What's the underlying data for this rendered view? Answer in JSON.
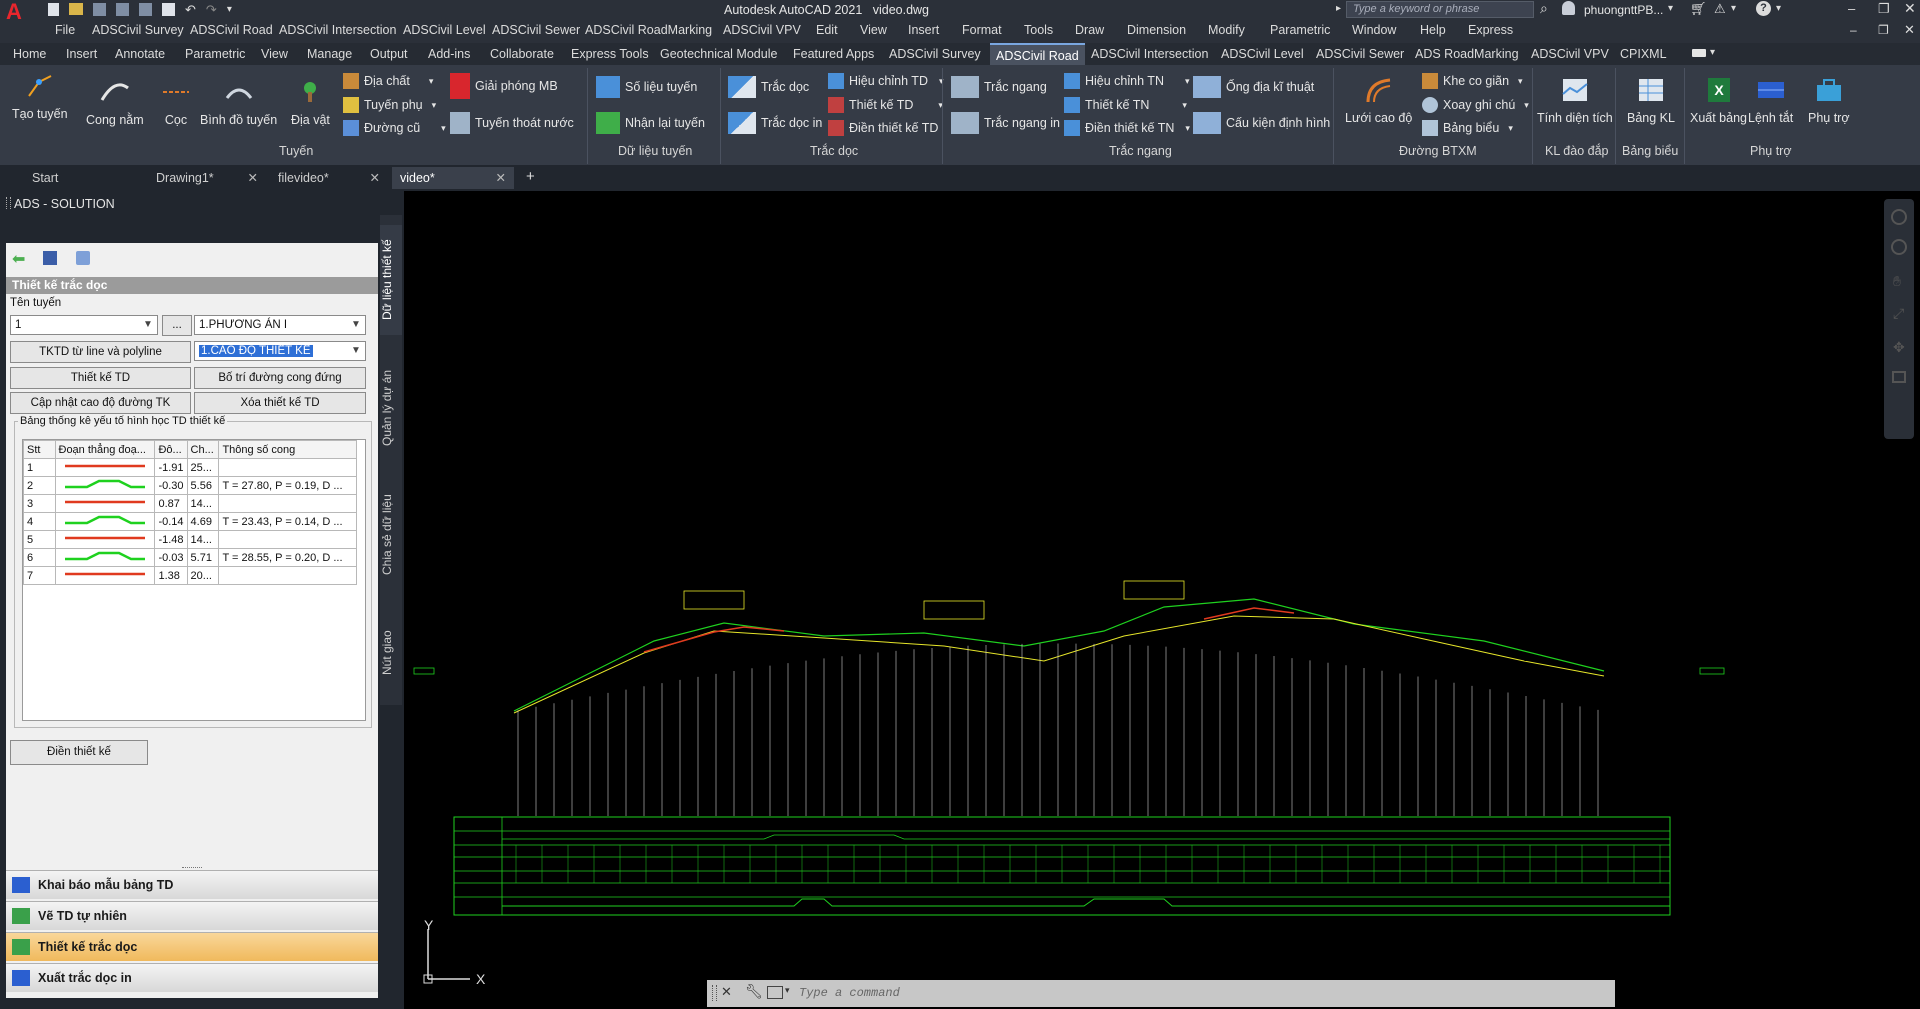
{
  "titlebar": {
    "app_title": "Autodesk AutoCAD 2021",
    "file_name": "video.dwg",
    "search_placeholder": "Type a keyword or phrase",
    "user_name": "phuongnttPB..."
  },
  "menubar": {
    "items": [
      "File",
      "ADSCivil Survey",
      "ADSCivil Road",
      "ADSCivil Intersection",
      "ADSCivil Level",
      "ADSCivil Sewer",
      "ADSCivil RoadMarking",
      "ADSCivil VPV",
      "Edit",
      "View",
      "Insert",
      "Format",
      "Tools",
      "Draw",
      "Dimension",
      "Modify",
      "Parametric",
      "Window",
      "Help",
      "Express"
    ]
  },
  "ribbon_tabs": {
    "items": [
      "Home",
      "Insert",
      "Annotate",
      "Parametric",
      "View",
      "Manage",
      "Output",
      "Add-ins",
      "Collaborate",
      "Express Tools",
      "Geotechnical Module",
      "Featured Apps",
      "ADSCivil Survey",
      "ADSCivil Road",
      "ADSCivil Intersection",
      "ADSCivil Level",
      "ADSCivil Sewer",
      "ADS RoadMarking",
      "ADSCivil VPV",
      "CPIXML"
    ],
    "active": "ADSCivil Road"
  },
  "ribbon": {
    "tuyen": {
      "title": "Tuyến",
      "tao_tuyen": "Tạo tuyến",
      "cong_nam": "Cong nằm",
      "coc": "Cọc",
      "binh_do_tuyen": "Bình đồ tuyến",
      "dia_vat": "Địa vật",
      "dia_chat": "Địa chất",
      "tuyen_phu": "Tuyến phụ",
      "duong_cu": "Đường cũ",
      "giai_phong_mb": "Giải phóng MB",
      "tuyen_thoat_nuoc": "Tuyến thoát nước"
    },
    "du_lieu_tuyen": {
      "title": "Dữ liệu tuyến",
      "so_lieu_tuyen": "Số liệu tuyến",
      "nhan_lai_tuyen": "Nhận lại tuyến"
    },
    "trac_doc": {
      "title": "Trắc dọc",
      "trac_doc": "Trắc dọc",
      "trac_doc_in": "Trắc dọc in",
      "hieu_chinh_td": "Hiệu chỉnh TD",
      "thiet_ke_td": "Thiết kế TD",
      "dien_thiet_ke_td": "Điền thiết kế TD"
    },
    "trac_ngang": {
      "title": "Trắc ngang",
      "trac_ngang": "Trắc ngang",
      "trac_ngang_in": "Trắc ngang in",
      "hieu_chinh_tn": "Hiệu chỉnh TN",
      "thiet_ke_tn": "Thiết kế TN",
      "dien_thiet_ke_tn": "Điền thiết kế TN",
      "ong_dia_ki_thuat": "Ống địa kĩ thuật",
      "cau_kien_dinh_hinh": "Cấu kiện định hình"
    },
    "duong_btxm": {
      "title": "Đường BTXM",
      "luoi_cao_do": "Lưới cao độ",
      "khe_co_gian": "Khe co giãn",
      "xoay_ghi_chu": "Xoay ghi chú",
      "bang_bieu": "Bảng biểu"
    },
    "kl_dao_dap": {
      "title": "KL đào đắp",
      "tinh_dien_tich": "Tính diện tích"
    },
    "bang_bieu_panel": {
      "title": "Bảng biểu",
      "bang_kl": "Bảng KL"
    },
    "phu_tro": {
      "title": "Phụ trợ",
      "xuat_bang": "Xuất bảng",
      "lenh_tat": "Lệnh tắt",
      "phu_tro": "Phụ trợ"
    }
  },
  "doc_tabs": {
    "items": [
      "Start",
      "Drawing1*",
      "filevideo*",
      "video*"
    ],
    "active": "video*"
  },
  "palette": {
    "header": "ADS - SOLUTION",
    "section_title": "Thiết kế trắc dọc",
    "ten_tuyen_label": "Tên tuyến",
    "ten_tuyen_value": "1",
    "browse_button": "...",
    "phuong_an_value": "1.PHƯƠNG ÁN I",
    "cao_do_value": "1.CAO ĐỘ THIẾT KẾ",
    "btn_tktd_line": "TKTD từ line và polyline",
    "btn_thiet_ke_td": "Thiết kế TD",
    "btn_bo_tri": "Bố trí đường cong đứng",
    "btn_cap_nhat": "Cập nhật cao độ đường TK",
    "btn_xoa": "Xóa thiết kế TD",
    "table_label": "Bảng thống kê yếu tố hình học TD thiết kế",
    "columns": [
      "Stt",
      "Đoạn thẳng đoạ...",
      "Đô...",
      "Ch...",
      "Thông số cong"
    ],
    "rows": [
      {
        "stt": "1",
        "type": "line",
        "do": "-1.91",
        "ch": "25...",
        "ts": ""
      },
      {
        "stt": "2",
        "type": "curve",
        "do": "-0.30",
        "ch": "5.56",
        "ts": "T = 27.80, P = 0.19, D ..."
      },
      {
        "stt": "3",
        "type": "line",
        "do": "0.87",
        "ch": "14...",
        "ts": ""
      },
      {
        "stt": "4",
        "type": "curve",
        "do": "-0.14",
        "ch": "4.69",
        "ts": "T = 23.43, P = 0.14, D ..."
      },
      {
        "stt": "5",
        "type": "line",
        "do": "-1.48",
        "ch": "14...",
        "ts": ""
      },
      {
        "stt": "6",
        "type": "curve",
        "do": "-0.03",
        "ch": "5.71",
        "ts": "T = 28.55, P = 0.20, D ..."
      },
      {
        "stt": "7",
        "type": "line",
        "do": "1.38",
        "ch": "20...",
        "ts": ""
      }
    ],
    "btn_dien": "Điền thiết kế",
    "nav": [
      {
        "label": "Khai báo mẫu bảng TD",
        "active": false
      },
      {
        "label": "Vẽ TD tự nhiên",
        "active": false
      },
      {
        "label": "Thiết kế trắc dọc",
        "active": true
      },
      {
        "label": "Xuất trắc dọc in",
        "active": false
      }
    ],
    "vertical_tabs": [
      "Dữ liệu thiết kế",
      "Quản lý dự án",
      "Chia sẻ dữ liệu",
      "Nút giao"
    ]
  },
  "canvas": {
    "ucs_y": "Y",
    "ucs_x": "X"
  },
  "command": {
    "placeholder": "Type a command"
  },
  "colors": {
    "accent": "#7aa7e0",
    "palette_active": "#f0b95c",
    "profile_green": "#1fd11f",
    "profile_yellow": "#e6e62a",
    "profile_red": "#e03a1f"
  }
}
